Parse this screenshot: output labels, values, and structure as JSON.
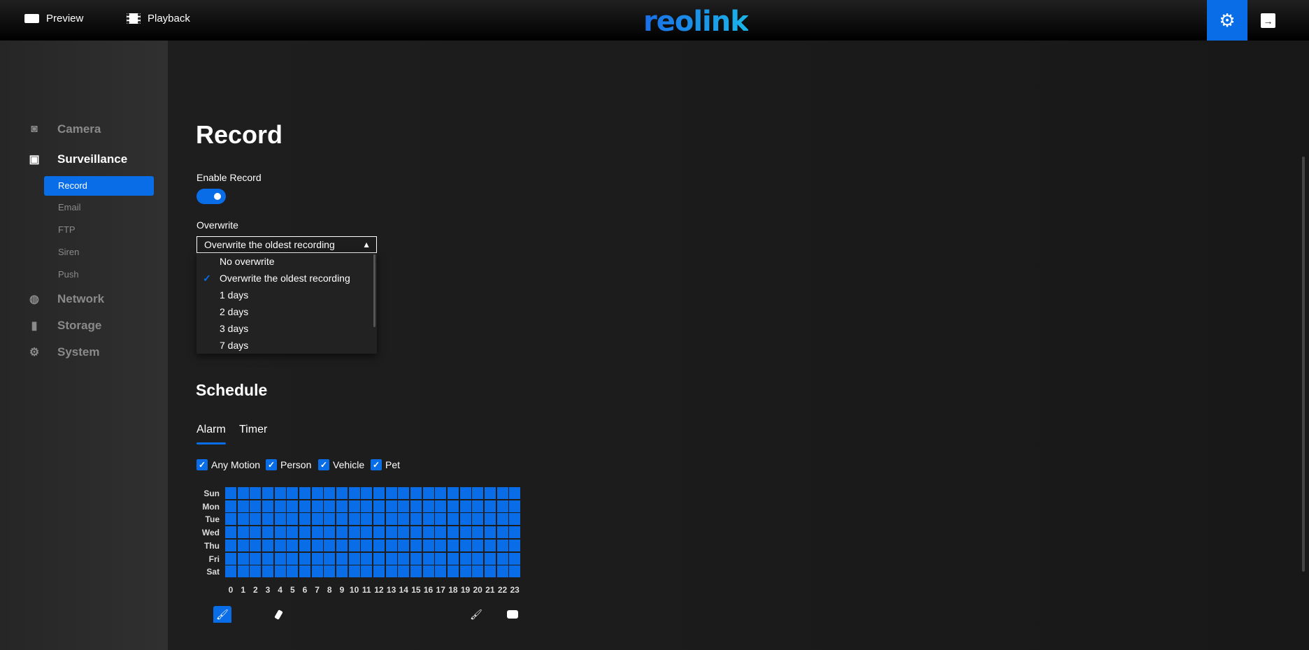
{
  "header": {
    "preview_label": "Preview",
    "playback_label": "Playback",
    "logo": "reolink",
    "settings_icon": "gear-icon",
    "logout_icon": "logout-icon",
    "accent": "#0a6de8"
  },
  "sidebar": {
    "sections": [
      {
        "label": "Camera",
        "icon": "camera-icon"
      },
      {
        "label": "Surveillance",
        "icon": "monitor-icon"
      },
      {
        "label": "Network",
        "icon": "globe-icon"
      },
      {
        "label": "Storage",
        "icon": "sd-card-icon"
      },
      {
        "label": "System",
        "icon": "gear-icon"
      }
    ],
    "sub_items": [
      {
        "label": "Record",
        "active": true
      },
      {
        "label": "Email"
      },
      {
        "label": "FTP"
      },
      {
        "label": "Siren"
      },
      {
        "label": "Push"
      }
    ]
  },
  "main": {
    "title": "Record",
    "enable_record": {
      "label": "Enable Record",
      "on": true
    },
    "overwrite": {
      "label": "Overwrite",
      "value": "Overwrite the oldest recording",
      "options": [
        "No overwrite",
        "Overwrite the oldest recording",
        "1 days",
        "2 days",
        "3 days",
        "7 days"
      ],
      "selected_index": 1
    },
    "schedule": {
      "title": "Schedule",
      "tabs": [
        "Alarm",
        "Timer"
      ],
      "active_tab": "Alarm",
      "filters": [
        {
          "label": "Any Motion",
          "checked": true
        },
        {
          "label": "Person",
          "checked": true
        },
        {
          "label": "Vehicle",
          "checked": true
        },
        {
          "label": "Pet",
          "checked": true
        }
      ],
      "days": [
        "Sun",
        "Mon",
        "Tue",
        "Wed",
        "Thu",
        "Fri",
        "Sat"
      ],
      "hours": [
        "0",
        "1",
        "2",
        "3",
        "4",
        "5",
        "6",
        "7",
        "8",
        "9",
        "10",
        "11",
        "12",
        "13",
        "14",
        "15",
        "16",
        "17",
        "18",
        "19",
        "20",
        "21",
        "22",
        "23"
      ],
      "grid": [
        "111111111111111111111111",
        "111111111111111111111111",
        "111111111111111111111111",
        "111111111111111111111111",
        "111111111111111111111111",
        "111111111111111111111111",
        "111111111111111111111111"
      ],
      "tools": [
        {
          "icon": "brush-icon",
          "active": true
        },
        {
          "icon": "eraser-icon"
        },
        {
          "icon": "brush-all-icon"
        },
        {
          "icon": "erase-all-icon"
        }
      ]
    }
  }
}
